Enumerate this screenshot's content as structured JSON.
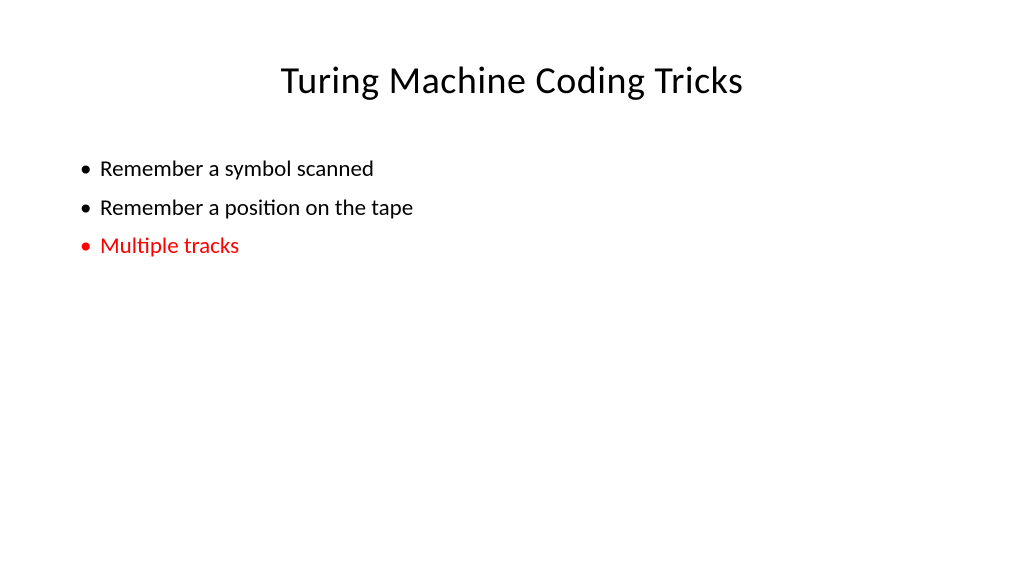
{
  "slide": {
    "title": "Turing Machine Coding Tricks",
    "bullets": [
      {
        "text": "Remember a symbol scanned",
        "highlighted": false
      },
      {
        "text": "Remember a position on the tape",
        "highlighted": false
      },
      {
        "text": "Multiple tracks",
        "highlighted": true
      }
    ]
  },
  "colors": {
    "text": "#000000",
    "highlight": "#ff0000",
    "background": "#ffffff"
  }
}
